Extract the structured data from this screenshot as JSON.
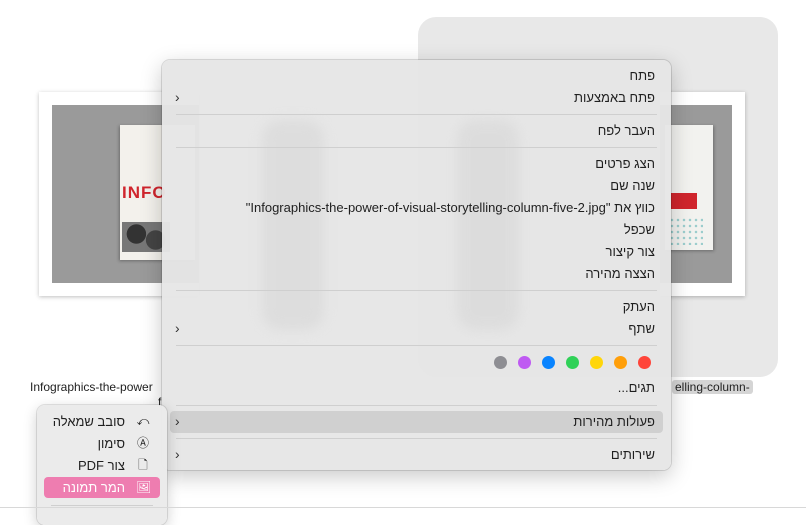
{
  "desktop": {
    "file_name_left": "Infographics-the-power",
    "file_name_left_line2": "f",
    "file_name_right": "elling-column-",
    "book_cover_text": "INFO"
  },
  "context_menu": {
    "open": "פתח",
    "open_with": "פתח באמצעות",
    "move_to_trash": "העבר לפח",
    "get_info": "הצג פרטים",
    "rename": "שנה שם",
    "compress": "כווץ את \"Infographics-the-power-of-visual-storytelling-column-five-2.jpg\"",
    "duplicate": "שכפל",
    "make_alias": "צור קיצור",
    "quick_look": "הצצה מהירה",
    "copy": "העתק",
    "share": "שתף",
    "tags": "תגים...",
    "quick_actions": "פעולות מהירות",
    "services": "שירותים",
    "tag_colors": [
      "#ff453a",
      "#ff9f0a",
      "#ffd60a",
      "#30d158",
      "#0a84ff",
      "#bf5af2",
      "#8e8e93"
    ]
  },
  "submenu": {
    "rotate_left": "סובב שמאלה",
    "markup": "סימון",
    "create_pdf": "צור PDF",
    "convert_image": "המר תמונה"
  }
}
